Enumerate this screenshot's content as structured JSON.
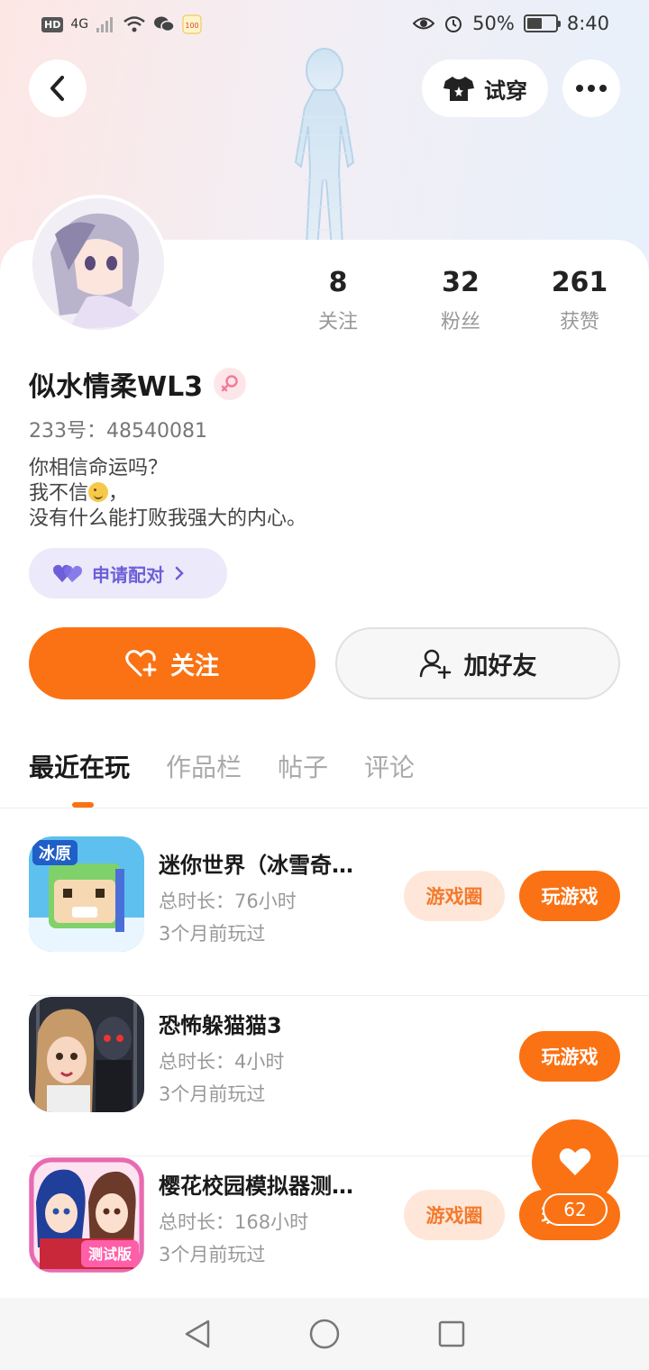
{
  "status_bar": {
    "left_badge": "HD",
    "network": "4G",
    "battery": "50%",
    "time": "8:40"
  },
  "top_bar": {
    "tryon_label": "试穿"
  },
  "profile": {
    "nickname": "似水情柔WL3",
    "uid": "233号：48540081",
    "bio_line1": "你相信命运吗？",
    "bio_line2_a": "我不信",
    "bio_line2_b": "，",
    "bio_line3": "没有什么能打败我强大的内心。",
    "pair_label": "申请配对",
    "stats": [
      {
        "num": "8",
        "label": "关注"
      },
      {
        "num": "32",
        "label": "粉丝"
      },
      {
        "num": "261",
        "label": "获赞"
      }
    ]
  },
  "actions": {
    "follow_label": "关注",
    "add_friend_label": "加好友"
  },
  "tabs": [
    "最近在玩",
    "作品栏",
    "帖子",
    "评论"
  ],
  "games": [
    {
      "title": "迷你世界（冰雪奇…",
      "duration": "总时长：76小时",
      "last_played": "3个月前玩过",
      "circle_label": "游戏圈",
      "play_label": "玩游戏"
    },
    {
      "title": "恐怖躲猫猫3",
      "duration": "总时长：4小时",
      "last_played": "3个月前玩过",
      "play_label": "玩游戏"
    },
    {
      "title": "樱花校园模拟器测…",
      "duration": "总时长：168小时",
      "last_played": "3个月前玩过",
      "circle_label": "游戏圈",
      "play_label": "玩游戏"
    }
  ],
  "icon_labels": {
    "game1_badge": "冰原",
    "game3_badge": "测试版"
  },
  "like": {
    "count": "62"
  },
  "colors": {
    "accent": "#fa7213",
    "pair_bg": "#ece9fb",
    "pair_text": "#6c5fd8"
  }
}
